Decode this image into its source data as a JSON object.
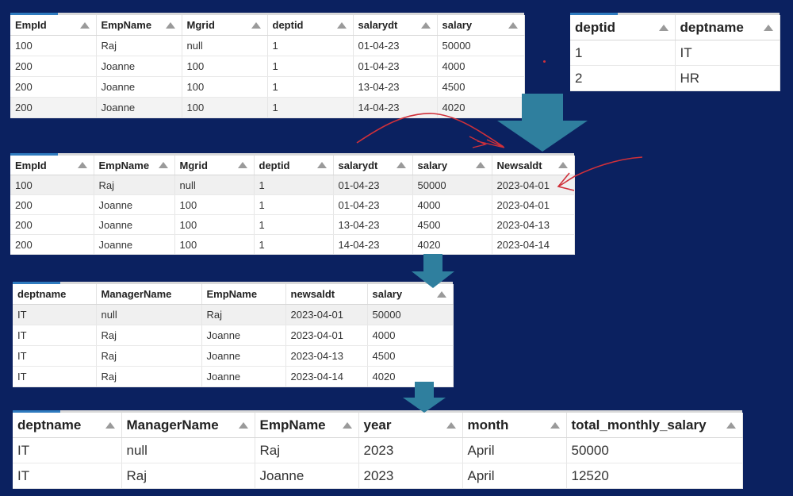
{
  "tables": {
    "employee": {
      "headers": [
        "EmpId",
        "EmpName",
        "Mgrid",
        "deptid",
        "salarydt",
        "salary"
      ],
      "rows": [
        [
          "100",
          "Raj",
          "null",
          "1",
          "01-04-23",
          "50000"
        ],
        [
          "200",
          "Joanne",
          "100",
          "1",
          "01-04-23",
          "4000"
        ],
        [
          "200",
          "Joanne",
          "100",
          "1",
          "13-04-23",
          "4500"
        ],
        [
          "200",
          "Joanne",
          "100",
          "1",
          "14-04-23",
          "4020"
        ]
      ]
    },
    "department": {
      "headers": [
        "deptid",
        "deptname"
      ],
      "rows": [
        [
          "1",
          "IT"
        ],
        [
          "2",
          "HR"
        ]
      ]
    },
    "with_newsaldt": {
      "headers": [
        "EmpId",
        "EmpName",
        "Mgrid",
        "deptid",
        "salarydt",
        "salary",
        "Newsaldt"
      ],
      "rows": [
        [
          "100",
          "Raj",
          "null",
          "1",
          "01-04-23",
          "50000",
          "2023-04-01"
        ],
        [
          "200",
          "Joanne",
          "100",
          "1",
          "01-04-23",
          "4000",
          "2023-04-01"
        ],
        [
          "200",
          "Joanne",
          "100",
          "1",
          "13-04-23",
          "4500",
          "2023-04-13"
        ],
        [
          "200",
          "Joanne",
          "100",
          "1",
          "14-04-23",
          "4020",
          "2023-04-14"
        ]
      ]
    },
    "joined": {
      "headers": [
        "deptname",
        "ManagerName",
        "EmpName",
        "newsaldt",
        "salary"
      ],
      "rows": [
        [
          "IT",
          "null",
          "Raj",
          "2023-04-01",
          "50000"
        ],
        [
          "IT",
          "Raj",
          "Joanne",
          "2023-04-01",
          "4000"
        ],
        [
          "IT",
          "Raj",
          "Joanne",
          "2023-04-13",
          "4500"
        ],
        [
          "IT",
          "Raj",
          "Joanne",
          "2023-04-14",
          "4020"
        ]
      ]
    },
    "monthly": {
      "headers": [
        "deptname",
        "ManagerName",
        "EmpName",
        "year",
        "month",
        "total_monthly_salary"
      ],
      "rows": [
        [
          "IT",
          "null",
          "Raj",
          "2023",
          "April",
          "50000"
        ],
        [
          "IT",
          "Raj",
          "Joanne",
          "2023",
          "April",
          "12520"
        ]
      ]
    }
  },
  "colors": {
    "background": "#0b2160",
    "arrow": "#2f7f9e",
    "annotation": "#d0303a"
  },
  "icons": {
    "sort": "triangle-up-icon",
    "flow": "down-arrow-icon"
  }
}
